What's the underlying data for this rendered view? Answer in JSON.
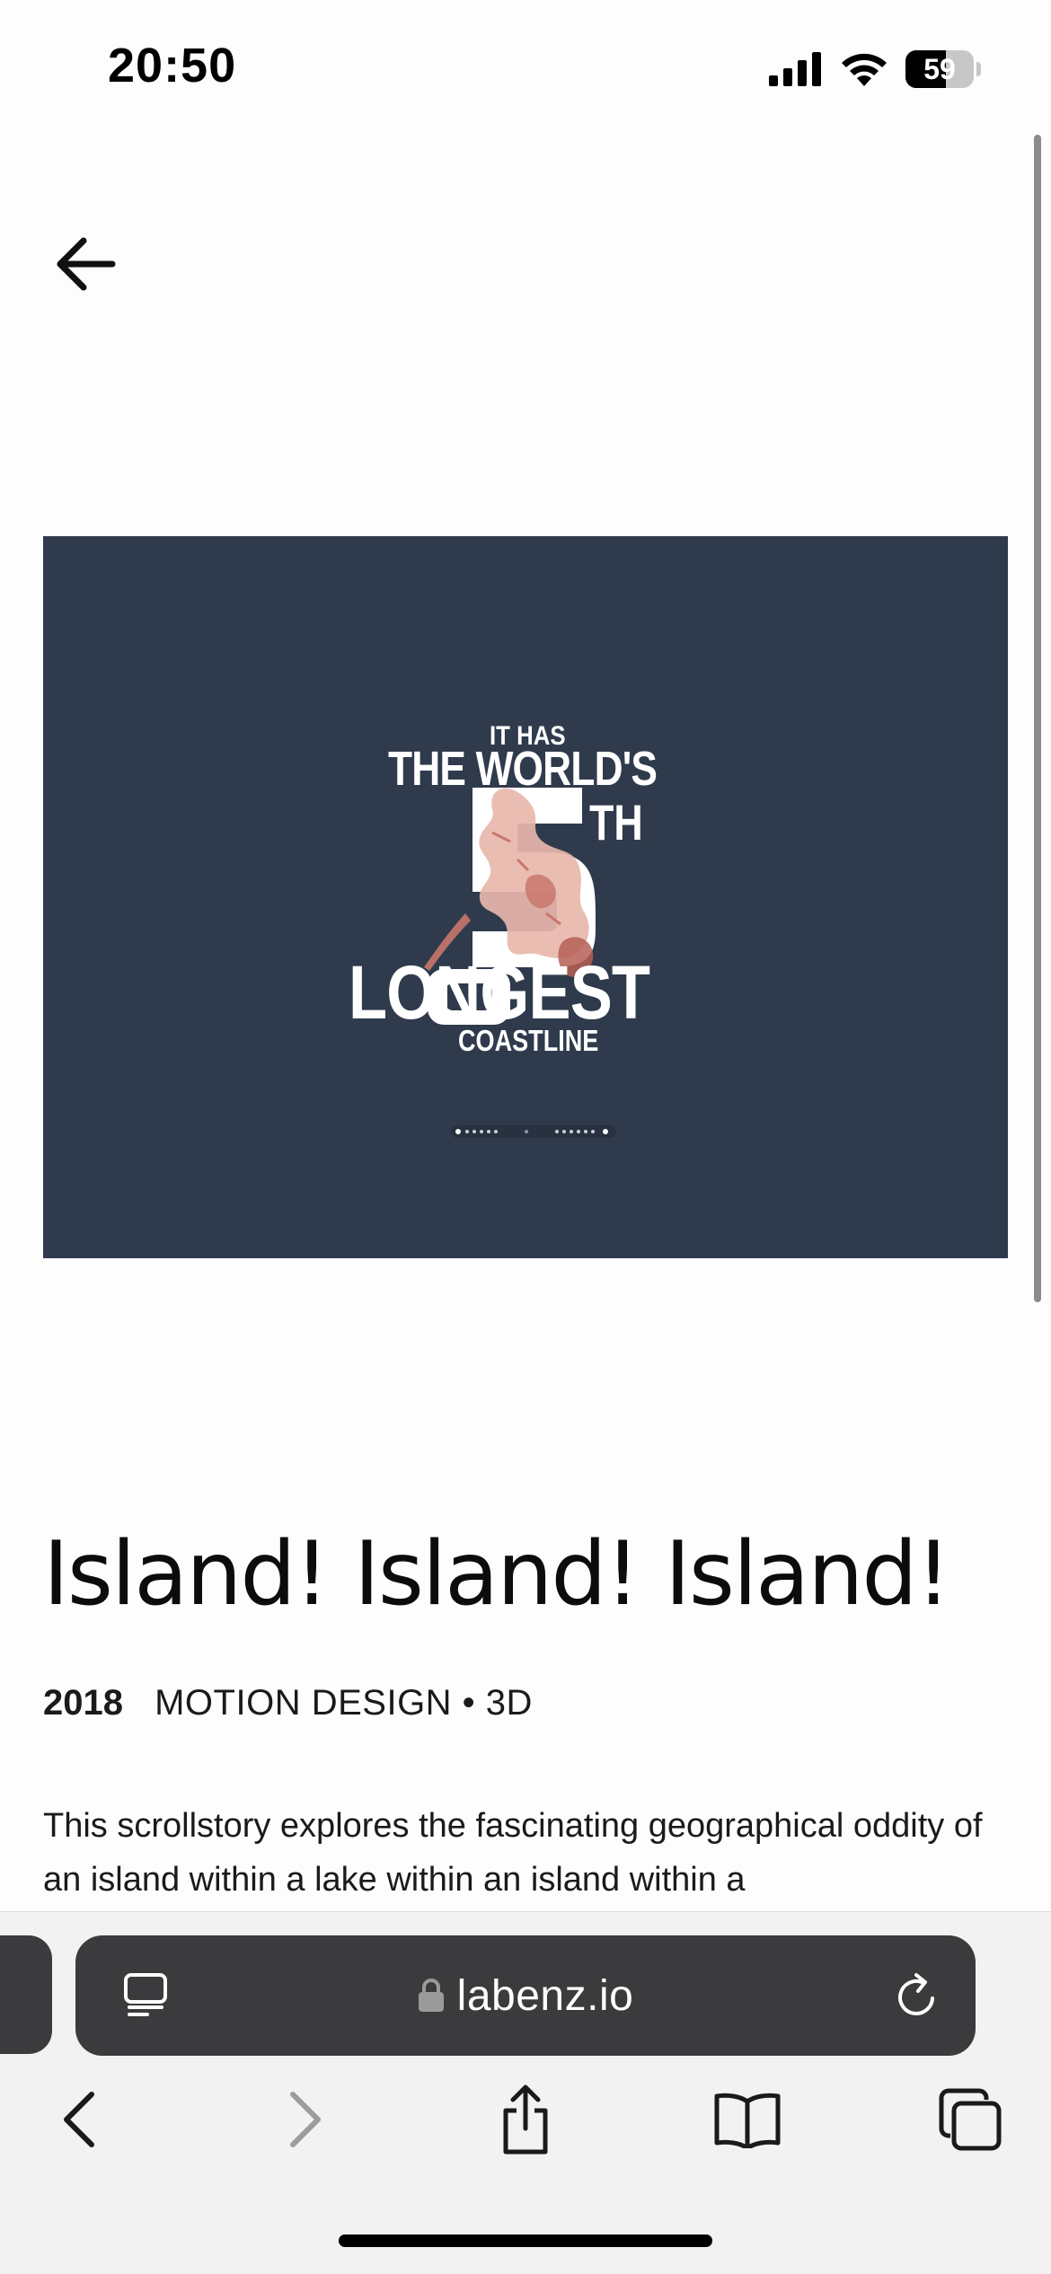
{
  "status_bar": {
    "time": "20:50",
    "battery": "59",
    "battery_level": 0.59
  },
  "hero": {
    "poster_lines": {
      "line1": "IT HAS",
      "line2": "THE WORLD'S",
      "number": "5",
      "suffix": "TH",
      "line4": "LONGEST",
      "line5": "COASTLINE"
    },
    "background_color": "#2f3b4c"
  },
  "project": {
    "title": "Island! Island! Island!",
    "year": "2018",
    "tags": "MOTION DESIGN • 3D",
    "description": "This scrollstory explores the fascinating geographical oddity of an island within a lake within an island within a"
  },
  "browser": {
    "url": "labenz.io",
    "icons": {
      "reader": "reader-mode-icon",
      "lock": "lock-icon",
      "reload": "reload-icon",
      "back": "chevron-left-icon",
      "forward": "chevron-right-icon",
      "share": "share-icon",
      "bookmarks": "book-icon",
      "tabs": "tabs-icon"
    }
  }
}
